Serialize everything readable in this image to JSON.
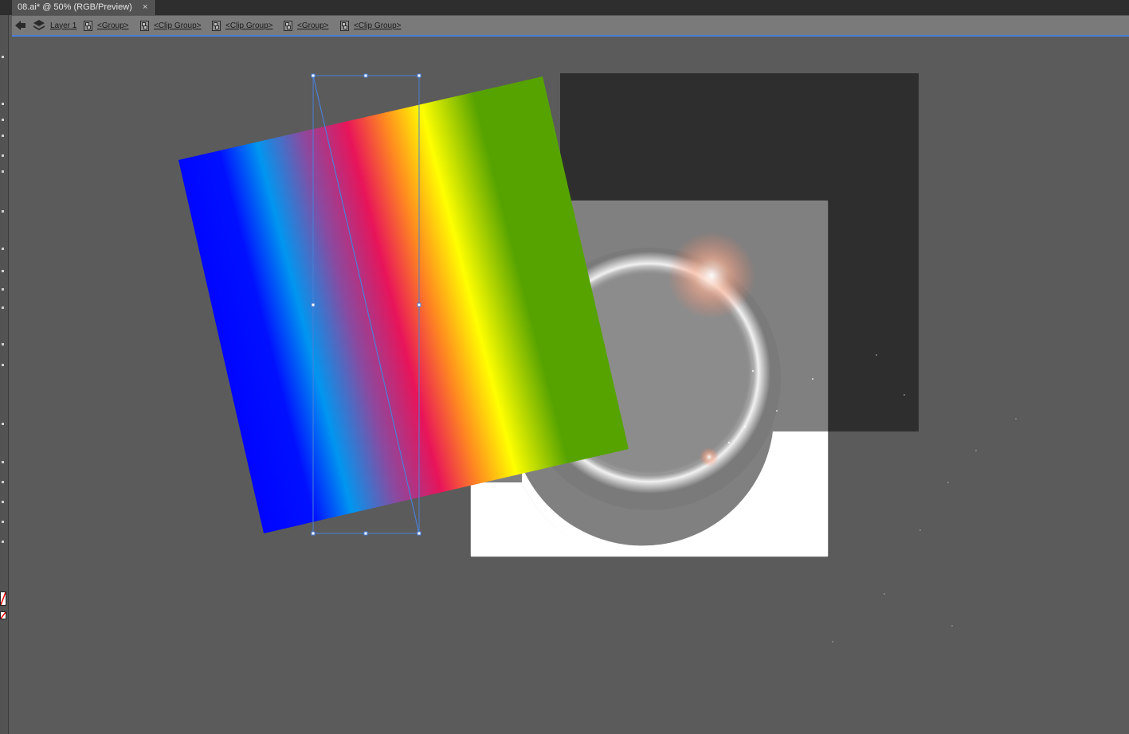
{
  "document_tab": {
    "title": "08.ai* @ 50% (RGB/Preview)",
    "close_glyph": "×"
  },
  "isolation_bar": {
    "back_icon": "back-arrow-icon",
    "layer_icon": "layers-icon",
    "crumbs": [
      {
        "label": "Layer 1"
      },
      {
        "label": "<Group>"
      },
      {
        "label": "<Clip Group>"
      },
      {
        "label": "<Clip Group>"
      },
      {
        "label": "<Group>"
      },
      {
        "label": "<Clip Group>"
      }
    ],
    "accent_color": "#4a7fd6"
  },
  "canvas": {
    "background": "#5b5b5b",
    "dark_rect_color": "#2e2e2e",
    "gray_square_color": "#808080",
    "gradient_stops": [
      "#0000ff",
      "#0096f0",
      "#e8145a",
      "#ffff00",
      "#56a300"
    ],
    "selection_color": "#4a7fd6"
  }
}
